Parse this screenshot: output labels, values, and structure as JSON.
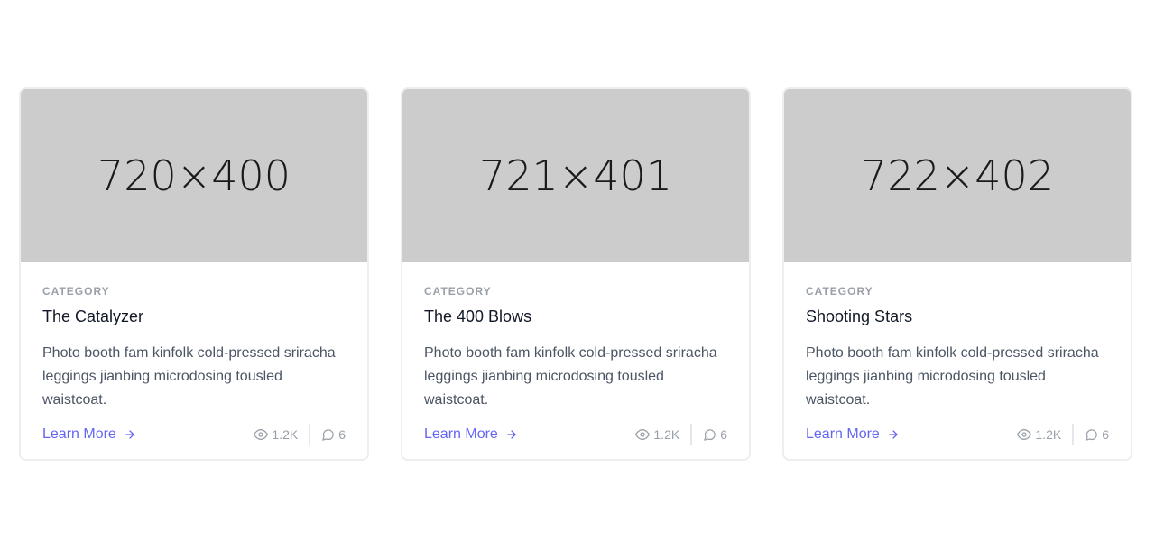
{
  "cards": [
    {
      "image_label": "720×400",
      "category": "CATEGORY",
      "title": "The Catalyzer",
      "description": "Photo booth fam kinfolk cold-pressed sriracha leggings jianbing microdosing tousled waistcoat.",
      "link_label": "Learn More",
      "views": "1.2K",
      "comments": "6"
    },
    {
      "image_label": "721×401",
      "category": "CATEGORY",
      "title": "The 400 Blows",
      "description": "Photo booth fam kinfolk cold-pressed sriracha leggings jianbing microdosing tousled waistcoat.",
      "link_label": "Learn More",
      "views": "1.2K",
      "comments": "6"
    },
    {
      "image_label": "722×402",
      "category": "CATEGORY",
      "title": "Shooting Stars",
      "description": "Photo booth fam kinfolk cold-pressed sriracha leggings jianbing microdosing tousled waistcoat.",
      "link_label": "Learn More",
      "views": "1.2K",
      "comments": "6"
    }
  ],
  "colors": {
    "accent": "#6366f1",
    "placeholder_bg": "#cccccc",
    "muted": "#9aa0a8"
  },
  "icons": {
    "arrow": "arrow-right-icon",
    "views": "eye-icon",
    "comments": "comment-icon"
  }
}
